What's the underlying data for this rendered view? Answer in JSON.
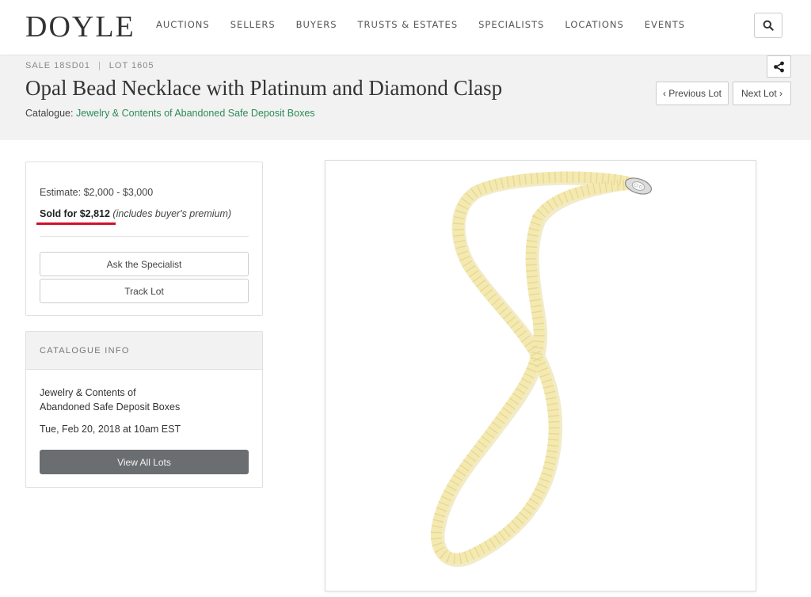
{
  "header": {
    "logo": "DOYLE",
    "nav": [
      "AUCTIONS",
      "SELLERS",
      "BUYERS",
      "TRUSTS & ESTATES",
      "SPECIALISTS",
      "LOCATIONS",
      "EVENTS"
    ],
    "search_icon": "search-icon"
  },
  "lot": {
    "sale": "SALE 18SD01",
    "separator": "|",
    "lot_number": "LOT 1605",
    "title": "Opal Bead Necklace with Platinum and Diamond Clasp",
    "catalogue_label": "Catalogue:",
    "catalogue_link": "Jewelry & Contents of Abandoned Safe Deposit Boxes",
    "prev_label": "‹ Previous Lot",
    "next_label": "Next Lot ›",
    "share_icon": "share-icon"
  },
  "pricing": {
    "estimate": "Estimate: $2,000 - $3,000",
    "sold": "Sold for $2,812",
    "sold_note": "(includes buyer's premium)",
    "ask_label": "Ask the Specialist",
    "track_label": "Track Lot"
  },
  "catalogue_info": {
    "heading": "CATALOGUE INFO",
    "name_line1": "Jewelry & Contents of",
    "name_line2": "Abandoned Safe Deposit Boxes",
    "date": "Tue, Feb 20, 2018 at 10am EST",
    "view_label": "View All Lots"
  },
  "colors": {
    "accent_link": "#2e8b57",
    "underline_red": "#d0112b",
    "bead": "#f1e6a4"
  }
}
